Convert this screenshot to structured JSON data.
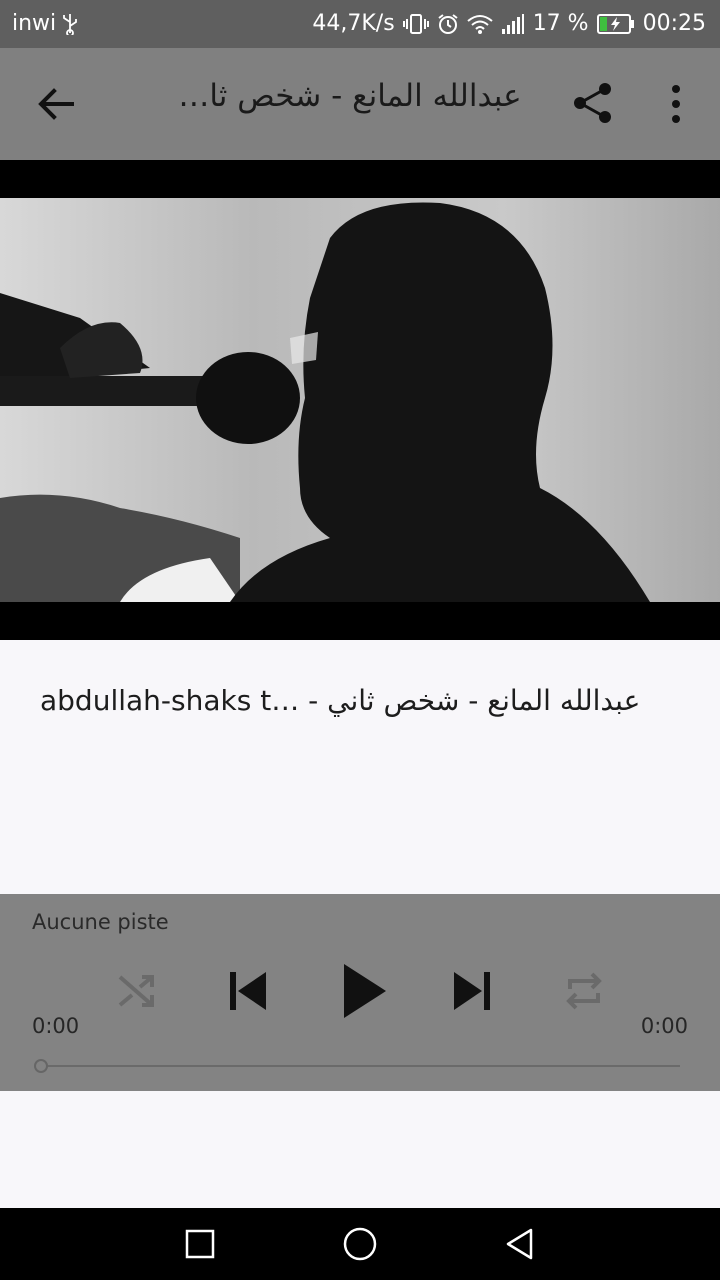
{
  "status_bar": {
    "carrier": "inwi",
    "network_speed": "44,7K/s",
    "battery_percent": "17 %",
    "time": "00:25"
  },
  "app_bar": {
    "title": "عبدالله المانع - شخص ثا…"
  },
  "track": {
    "name": "abdullah-shaks t… - عبدالله المانع - شخص ثاني"
  },
  "player": {
    "status": "Aucune piste",
    "elapsed": "0:00",
    "duration": "0:00",
    "progress": 0
  },
  "icons": {
    "back": "arrow-back-icon",
    "share": "share-icon",
    "more": "more-vert-icon",
    "shuffle": "shuffle-icon",
    "previous": "skip-previous-icon",
    "play": "play-icon",
    "next": "skip-next-icon",
    "repeat": "repeat-icon",
    "nav_recents": "recents-square-icon",
    "nav_home": "home-circle-icon",
    "nav_back": "back-triangle-icon"
  },
  "colors": {
    "status_bar": "#5f5f5f",
    "app_bar": "#808080",
    "player_panel": "#838383",
    "content_bg": "#f8f7fa"
  }
}
